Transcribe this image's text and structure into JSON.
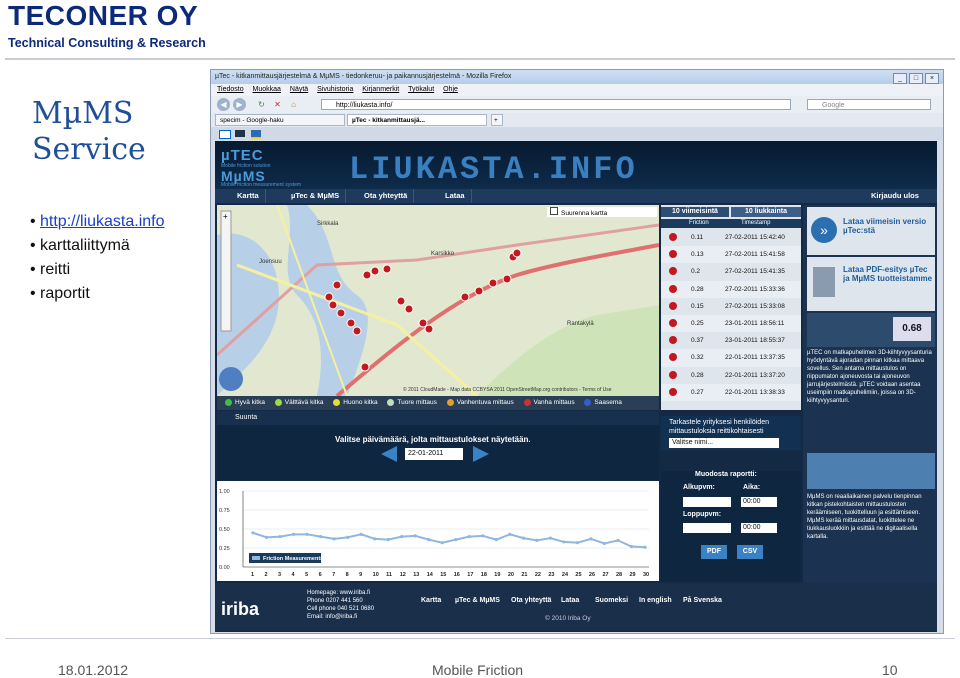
{
  "slide": {
    "brand": "TECONER OY",
    "tagline": "Technical Consulting & Research",
    "title_line1": "MµMS",
    "title_line2": "Service",
    "bullets": [
      "http://liukasta.info",
      "karttaliittymä",
      "reitti",
      "raportit"
    ],
    "footer_date": "18.01.2012",
    "footer_center": "Mobile Friction",
    "footer_page": "10"
  },
  "browser": {
    "window_title": "µTec - kitkanmittausjärjestelmä & MµMS - tiedonkeruu- ja paikannusjärjestelmä - Mozilla Firefox",
    "menu": [
      "Tiedosto",
      "Muokkaa",
      "Näytä",
      "Sivuhistoria",
      "Kirjanmerkit",
      "Työkalut",
      "Ohje"
    ],
    "url": "http://liukasta.info/",
    "search_placeholder": "Google",
    "bookmarks": [
      "specim - Google-haku",
      "µTec - kitkanmittausjä..."
    ],
    "tab_add": "+"
  },
  "site": {
    "logo_top": "µTEC",
    "logo_top_sub": "Mobile friction solution",
    "logo_bottom": "MµMS",
    "logo_bottom_sub": "Mobile friction measurement system",
    "banner": "LIUKASTA.INFO",
    "nav": [
      "Kartta",
      "µTec & MµMS",
      "Ota yhteyttä",
      "Lataa"
    ],
    "login": "Kirjaudu ulos",
    "map_checkbox": "Suurenna kartta",
    "map_attribution": "© 2011 CloudMade - Map data CCBYSA 2011 OpenStreetMap.org contributors - Terms of Use",
    "map_labels": [
      "Joensuu",
      "Karsikko",
      "Sirkkala",
      "Rantakylä"
    ],
    "legend": [
      "Hyvä kitka",
      "Välttävä kitka",
      "Huono kitka",
      "Tuore mittaus",
      "Vanhentuva mittaus",
      "Vanha mittaus",
      "Saasema"
    ],
    "legend_colors": [
      "#3fbf3f",
      "#9fd84a",
      "#e0e030",
      "#bfe0bf",
      "#e0a030",
      "#d03030",
      "#3060d0"
    ],
    "suunta": "Suunta",
    "results_tabs": [
      "10 viimeisintä",
      "10 liukkainta"
    ],
    "results_cols": [
      "Friction",
      "Timestamp"
    ],
    "results": [
      {
        "friction": "0.11",
        "timestamp": "27-02-2011 15:42:40"
      },
      {
        "friction": "0.13",
        "timestamp": "27-02-2011 15:41:58"
      },
      {
        "friction": "0.2",
        "timestamp": "27-02-2011 15:41:35"
      },
      {
        "friction": "0.28",
        "timestamp": "27-02-2011 15:33:36"
      },
      {
        "friction": "0.15",
        "timestamp": "27-02-2011 15:33:08"
      },
      {
        "friction": "0.25",
        "timestamp": "23-01-2011 18:56:11"
      },
      {
        "friction": "0.37",
        "timestamp": "23-01-2011 18:55:37"
      },
      {
        "friction": "0.32",
        "timestamp": "22-01-2011 13:37:35"
      },
      {
        "friction": "0.28",
        "timestamp": "22-01-2011 13:37:20"
      },
      {
        "friction": "0.27",
        "timestamp": "22-01-2011 13:38:33"
      }
    ],
    "company_title": "Tarkastele yrityksesi henkilöiden mittaustuloksia reittikohtaisesti",
    "company_select": "Valitse nimi...",
    "date_title": "Valitse päivämäärä, jolta mittaustulokset näytetään.",
    "date_value": "22-01-2011",
    "report_title": "Muodosta raportti:",
    "report_start": "Alkupvm:",
    "report_time": "Aika:",
    "report_end": "Loppupvm:",
    "report_time_value": "00:00",
    "report_buttons": [
      "PDF",
      "CSV"
    ],
    "ad1_title": "Lataa viimeisin versio µTec:stä",
    "ad2_title": "Lataa PDF-esitys µTec ja MµMS tuotteistamme",
    "ad_utec_value": "0.68",
    "ad_utec_text": "µTEC on matkapuhelimen 3D-kiihtyvyysanturia hyödyntävä ajoradan pinnan kitkaa mittaava sovellus. Sen antama mittaustulos on riippumaton ajoneuvosta tai ajoneuvon jarrujärjestelmästä. µTEC voidaan asentaa useimpiin matkapuhelimiin, joissa on 3D-kiihtyvyysanturi.",
    "ad_mums_text": "MµMS on reaaliaikainen palvelu tienpinnan kitkan pistekohtaisten mittaustulosten keräämiseen, tuokittelluun ja esittämiseen. MµMS kerää mittausdatat, luokittelee ne tiukkausluokkiin ja esittää ne digitaalisella kartalla.",
    "footer_company": "iriba",
    "footer_contact": [
      "Homepage: www.iriba.fi",
      "Phone 0207 441 560",
      "Cell phone 040 521 0680",
      "Email: info@iriba.fi"
    ],
    "footer_links": [
      "Kartta",
      "µTec & MµMS",
      "Ota yhteyttä",
      "Lataa",
      "Suomeksi",
      "In english",
      "På Svenska"
    ],
    "footer_copyright": "© 2010 Iriba Oy"
  },
  "chart_data": {
    "type": "line",
    "title": "",
    "xlabel": "",
    "ylabel": "",
    "x": [
      1,
      2,
      3,
      4,
      5,
      6,
      7,
      8,
      9,
      10,
      11,
      12,
      13,
      14,
      15,
      16,
      17,
      18,
      19,
      20,
      21,
      22,
      23,
      24,
      25,
      26,
      27,
      28,
      29,
      30
    ],
    "series": [
      {
        "name": "Friction Measurements",
        "values": [
          0.45,
          0.39,
          0.4,
          0.43,
          0.43,
          0.4,
          0.37,
          0.39,
          0.43,
          0.37,
          0.36,
          0.4,
          0.41,
          0.36,
          0.32,
          0.36,
          0.4,
          0.41,
          0.36,
          0.43,
          0.38,
          0.35,
          0.38,
          0.33,
          0.32,
          0.37,
          0.31,
          0.35,
          0.27,
          0.26
        ]
      }
    ],
    "y_ticks": [
      "1.00",
      "0.75",
      "0.50",
      "0.25",
      "0.00"
    ],
    "ylim": [
      0,
      1
    ],
    "grid": true,
    "color": "#8eb8e0"
  }
}
